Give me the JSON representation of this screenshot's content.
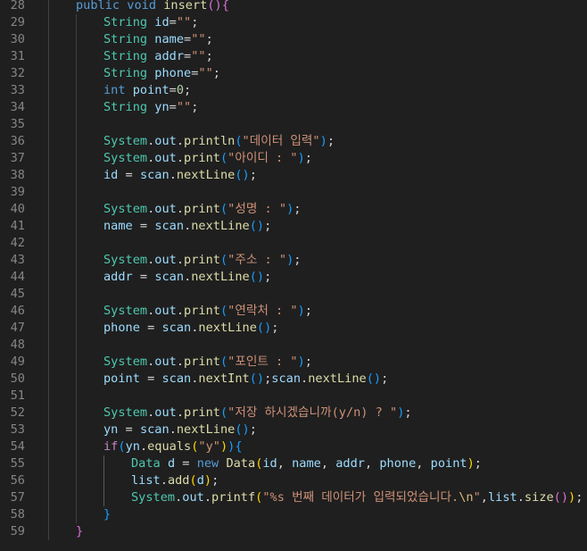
{
  "editor": {
    "line_numbers": [
      "28",
      "29",
      "30",
      "31",
      "32",
      "33",
      "34",
      "35",
      "36",
      "37",
      "38",
      "39",
      "40",
      "41",
      "42",
      "43",
      "44",
      "45",
      "46",
      "47",
      "48",
      "49",
      "50",
      "51",
      "52",
      "53",
      "54",
      "55",
      "56",
      "57",
      "58",
      "59"
    ],
    "lines": [
      {
        "indent": 4,
        "tokens": [
          [
            "kw",
            "public"
          ],
          [
            "pun",
            " "
          ],
          [
            "kw",
            "void"
          ],
          [
            "pun",
            " "
          ],
          [
            "fn",
            "insert"
          ],
          [
            "b2",
            "()"
          ],
          [
            "b2",
            "{"
          ]
        ]
      },
      {
        "indent": 8,
        "tokens": [
          [
            "ty",
            "String"
          ],
          [
            "pun",
            " "
          ],
          [
            "var",
            "id"
          ],
          [
            "pun",
            "="
          ],
          [
            "str",
            "\"\""
          ],
          [
            "pun",
            ";"
          ]
        ]
      },
      {
        "indent": 8,
        "tokens": [
          [
            "ty",
            "String"
          ],
          [
            "pun",
            " "
          ],
          [
            "var",
            "name"
          ],
          [
            "pun",
            "="
          ],
          [
            "str",
            "\"\""
          ],
          [
            "pun",
            ";"
          ]
        ]
      },
      {
        "indent": 8,
        "tokens": [
          [
            "ty",
            "String"
          ],
          [
            "pun",
            " "
          ],
          [
            "var",
            "addr"
          ],
          [
            "pun",
            "="
          ],
          [
            "str",
            "\"\""
          ],
          [
            "pun",
            ";"
          ]
        ]
      },
      {
        "indent": 8,
        "tokens": [
          [
            "ty",
            "String"
          ],
          [
            "pun",
            " "
          ],
          [
            "var",
            "phone"
          ],
          [
            "pun",
            "="
          ],
          [
            "str",
            "\"\""
          ],
          [
            "pun",
            ";"
          ]
        ]
      },
      {
        "indent": 8,
        "tokens": [
          [
            "kw",
            "int"
          ],
          [
            "pun",
            " "
          ],
          [
            "var",
            "point"
          ],
          [
            "pun",
            "="
          ],
          [
            "num",
            "0"
          ],
          [
            "pun",
            ";"
          ]
        ]
      },
      {
        "indent": 8,
        "tokens": [
          [
            "ty",
            "String"
          ],
          [
            "pun",
            " "
          ],
          [
            "var",
            "yn"
          ],
          [
            "pun",
            "="
          ],
          [
            "str",
            "\"\""
          ],
          [
            "pun",
            ";"
          ]
        ]
      },
      {
        "indent": 8,
        "tokens": []
      },
      {
        "indent": 8,
        "tokens": [
          [
            "ty",
            "System"
          ],
          [
            "pun",
            "."
          ],
          [
            "var",
            "out"
          ],
          [
            "pun",
            "."
          ],
          [
            "fn",
            "println"
          ],
          [
            "b3",
            "("
          ],
          [
            "str",
            "\"데이터 입력\""
          ],
          [
            "b3",
            ")"
          ],
          [
            "pun",
            ";"
          ]
        ]
      },
      {
        "indent": 8,
        "tokens": [
          [
            "ty",
            "System"
          ],
          [
            "pun",
            "."
          ],
          [
            "var",
            "out"
          ],
          [
            "pun",
            "."
          ],
          [
            "fn",
            "print"
          ],
          [
            "b3",
            "("
          ],
          [
            "str",
            "\"아이디 : \""
          ],
          [
            "b3",
            ")"
          ],
          [
            "pun",
            ";"
          ]
        ]
      },
      {
        "indent": 8,
        "tokens": [
          [
            "var",
            "id"
          ],
          [
            "pun",
            " = "
          ],
          [
            "var",
            "scan"
          ],
          [
            "pun",
            "."
          ],
          [
            "fn",
            "nextLine"
          ],
          [
            "b3",
            "()"
          ],
          [
            "pun",
            ";"
          ]
        ]
      },
      {
        "indent": 8,
        "tokens": []
      },
      {
        "indent": 8,
        "tokens": [
          [
            "ty",
            "System"
          ],
          [
            "pun",
            "."
          ],
          [
            "var",
            "out"
          ],
          [
            "pun",
            "."
          ],
          [
            "fn",
            "print"
          ],
          [
            "b3",
            "("
          ],
          [
            "str",
            "\"성명 : \""
          ],
          [
            "b3",
            ")"
          ],
          [
            "pun",
            ";"
          ]
        ]
      },
      {
        "indent": 8,
        "tokens": [
          [
            "var",
            "name"
          ],
          [
            "pun",
            " = "
          ],
          [
            "var",
            "scan"
          ],
          [
            "pun",
            "."
          ],
          [
            "fn",
            "nextLine"
          ],
          [
            "b3",
            "()"
          ],
          [
            "pun",
            ";"
          ]
        ]
      },
      {
        "indent": 8,
        "tokens": []
      },
      {
        "indent": 8,
        "tokens": [
          [
            "ty",
            "System"
          ],
          [
            "pun",
            "."
          ],
          [
            "var",
            "out"
          ],
          [
            "pun",
            "."
          ],
          [
            "fn",
            "print"
          ],
          [
            "b3",
            "("
          ],
          [
            "str",
            "\"주소 : \""
          ],
          [
            "b3",
            ")"
          ],
          [
            "pun",
            ";"
          ]
        ]
      },
      {
        "indent": 8,
        "tokens": [
          [
            "var",
            "addr"
          ],
          [
            "pun",
            " = "
          ],
          [
            "var",
            "scan"
          ],
          [
            "pun",
            "."
          ],
          [
            "fn",
            "nextLine"
          ],
          [
            "b3",
            "()"
          ],
          [
            "pun",
            ";"
          ]
        ]
      },
      {
        "indent": 8,
        "tokens": []
      },
      {
        "indent": 8,
        "tokens": [
          [
            "ty",
            "System"
          ],
          [
            "pun",
            "."
          ],
          [
            "var",
            "out"
          ],
          [
            "pun",
            "."
          ],
          [
            "fn",
            "print"
          ],
          [
            "b3",
            "("
          ],
          [
            "str",
            "\"연락처 : \""
          ],
          [
            "b3",
            ")"
          ],
          [
            "pun",
            ";"
          ]
        ]
      },
      {
        "indent": 8,
        "tokens": [
          [
            "var",
            "phone"
          ],
          [
            "pun",
            " = "
          ],
          [
            "var",
            "scan"
          ],
          [
            "pun",
            "."
          ],
          [
            "fn",
            "nextLine"
          ],
          [
            "b3",
            "()"
          ],
          [
            "pun",
            ";"
          ]
        ]
      },
      {
        "indent": 8,
        "tokens": []
      },
      {
        "indent": 8,
        "tokens": [
          [
            "ty",
            "System"
          ],
          [
            "pun",
            "."
          ],
          [
            "var",
            "out"
          ],
          [
            "pun",
            "."
          ],
          [
            "fn",
            "print"
          ],
          [
            "b3",
            "("
          ],
          [
            "str",
            "\"포인트 : \""
          ],
          [
            "b3",
            ")"
          ],
          [
            "pun",
            ";"
          ]
        ]
      },
      {
        "indent": 8,
        "tokens": [
          [
            "var",
            "point"
          ],
          [
            "pun",
            " = "
          ],
          [
            "var",
            "scan"
          ],
          [
            "pun",
            "."
          ],
          [
            "fn",
            "nextInt"
          ],
          [
            "b3",
            "()"
          ],
          [
            "pun",
            ";"
          ],
          [
            "var",
            "scan"
          ],
          [
            "pun",
            "."
          ],
          [
            "fn",
            "nextLine"
          ],
          [
            "b3",
            "()"
          ],
          [
            "pun",
            ";"
          ]
        ]
      },
      {
        "indent": 8,
        "tokens": []
      },
      {
        "indent": 8,
        "tokens": [
          [
            "ty",
            "System"
          ],
          [
            "pun",
            "."
          ],
          [
            "var",
            "out"
          ],
          [
            "pun",
            "."
          ],
          [
            "fn",
            "print"
          ],
          [
            "b3",
            "("
          ],
          [
            "str",
            "\"저장 하시겠습니까(y/n) ? \""
          ],
          [
            "b3",
            ")"
          ],
          [
            "pun",
            ";"
          ]
        ]
      },
      {
        "indent": 8,
        "tokens": [
          [
            "var",
            "yn"
          ],
          [
            "pun",
            " = "
          ],
          [
            "var",
            "scan"
          ],
          [
            "pun",
            "."
          ],
          [
            "fn",
            "nextLine"
          ],
          [
            "b3",
            "()"
          ],
          [
            "pun",
            ";"
          ]
        ]
      },
      {
        "indent": 8,
        "tokens": [
          [
            "cf",
            "if"
          ],
          [
            "b3",
            "("
          ],
          [
            "var",
            "yn"
          ],
          [
            "pun",
            "."
          ],
          [
            "fn",
            "equals"
          ],
          [
            "b1",
            "("
          ],
          [
            "str",
            "\"y\""
          ],
          [
            "b1",
            ")"
          ],
          [
            "b3",
            ")"
          ],
          [
            "b3",
            "{"
          ]
        ]
      },
      {
        "indent": 12,
        "tokens": [
          [
            "ty",
            "Data"
          ],
          [
            "pun",
            " "
          ],
          [
            "var",
            "d"
          ],
          [
            "pun",
            " = "
          ],
          [
            "kw",
            "new"
          ],
          [
            "pun",
            " "
          ],
          [
            "fn",
            "Data"
          ],
          [
            "b1",
            "("
          ],
          [
            "var",
            "id"
          ],
          [
            "pun",
            ", "
          ],
          [
            "var",
            "name"
          ],
          [
            "pun",
            ", "
          ],
          [
            "var",
            "addr"
          ],
          [
            "pun",
            ", "
          ],
          [
            "var",
            "phone"
          ],
          [
            "pun",
            ", "
          ],
          [
            "var",
            "point"
          ],
          [
            "b1",
            ")"
          ],
          [
            "pun",
            ";"
          ]
        ]
      },
      {
        "indent": 12,
        "tokens": [
          [
            "var",
            "list"
          ],
          [
            "pun",
            "."
          ],
          [
            "fn",
            "add"
          ],
          [
            "b1",
            "("
          ],
          [
            "var",
            "d"
          ],
          [
            "b1",
            ")"
          ],
          [
            "pun",
            ";"
          ]
        ]
      },
      {
        "indent": 12,
        "tokens": [
          [
            "ty",
            "System"
          ],
          [
            "pun",
            "."
          ],
          [
            "var",
            "out"
          ],
          [
            "pun",
            "."
          ],
          [
            "fn",
            "printf"
          ],
          [
            "b1",
            "("
          ],
          [
            "str",
            "\"%s 번째 데이터가 입력되었습니다."
          ],
          [
            "esc",
            "\\n"
          ],
          [
            "str",
            "\""
          ],
          [
            "pun",
            ","
          ],
          [
            "var",
            "list"
          ],
          [
            "pun",
            "."
          ],
          [
            "fn",
            "size"
          ],
          [
            "b2",
            "()"
          ],
          [
            "b1",
            ")"
          ],
          [
            "pun",
            ";"
          ]
        ]
      },
      {
        "indent": 8,
        "tokens": [
          [
            "b3",
            "}"
          ]
        ]
      },
      {
        "indent": 4,
        "tokens": [
          [
            "b2",
            "}"
          ]
        ]
      }
    ]
  }
}
